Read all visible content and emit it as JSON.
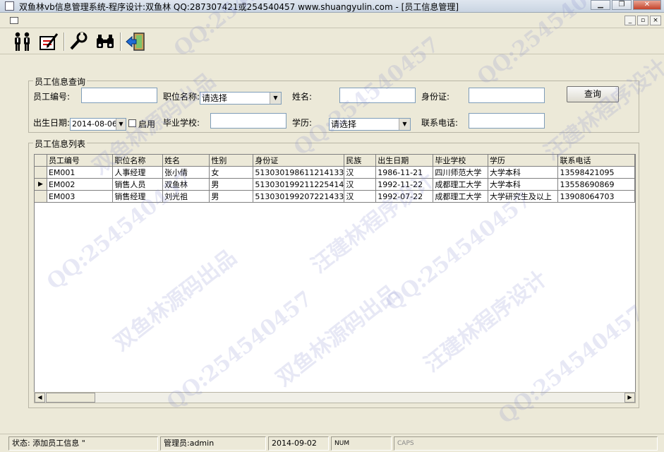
{
  "window": {
    "title": "双鱼林vb信息管理系统-程序设计:双鱼林 QQ:287307421或254540457 www.shuangyulin.com - [员工信息管理]",
    "controls": [
      "minimize",
      "restore",
      "close"
    ]
  },
  "mdi_controls": [
    "_",
    "▫",
    "×"
  ],
  "toolbar": {
    "buttons": [
      {
        "name": "people-icon"
      },
      {
        "name": "edit-document-icon"
      },
      {
        "name": "wrench-icon"
      },
      {
        "name": "binoculars-icon"
      },
      {
        "name": "exit-door-icon"
      }
    ]
  },
  "query": {
    "group_label": "员工信息查询",
    "employee_no_label": "员工编号:",
    "position_label": "职位名称:",
    "position_value": "请选择",
    "name_label": "姓名:",
    "id_card_label": "身份证:",
    "query_button": "查询",
    "birth_label": "出生日期:",
    "birth_value": "2014-08-06",
    "enable_label": "启用",
    "school_label": "毕业学校:",
    "education_label": "学历:",
    "education_value": "请选择",
    "phone_label": "联系电话:"
  },
  "list": {
    "group_label": "员工信息列表",
    "columns": [
      "员工编号",
      "职位名称",
      "姓名",
      "性别",
      "身份证",
      "民族",
      "出生日期",
      "毕业学校",
      "学历",
      "联系电话"
    ],
    "rows": [
      {
        "selected": false,
        "cells": [
          "EM001",
          "人事经理",
          "张小倩",
          "女",
          "513030198611214133",
          "汉",
          "1986-11-21",
          "四川师范大学",
          "大学本科",
          "13598421095"
        ]
      },
      {
        "selected": true,
        "cells": [
          "EM002",
          "销售人员",
          "双鱼林",
          "男",
          "513030199211225414",
          "汉",
          "1992-11-22",
          "成都理工大学",
          "大学本科",
          "13558690869"
        ]
      },
      {
        "selected": false,
        "cells": [
          "EM003",
          "销售经理",
          "刘光祖",
          "男",
          "513030199207221433",
          "汉",
          "1992-07-22",
          "成都理工大学",
          "大学研究生及以上",
          "13908064703"
        ]
      }
    ]
  },
  "statusbar": {
    "status": "状态:  添加员工信息 \"",
    "admin": "管理员:admin",
    "date": "2014-09-02",
    "num": "NUM",
    "caps": "CAPS"
  },
  "watermarks": {
    "qq": "QQ:254540457",
    "brand1": "双鱼林源码出品",
    "brand2": "汪建林程序设计"
  },
  "colors": {
    "window_bg": "#ece9d8",
    "watermark": "#7882c8"
  }
}
